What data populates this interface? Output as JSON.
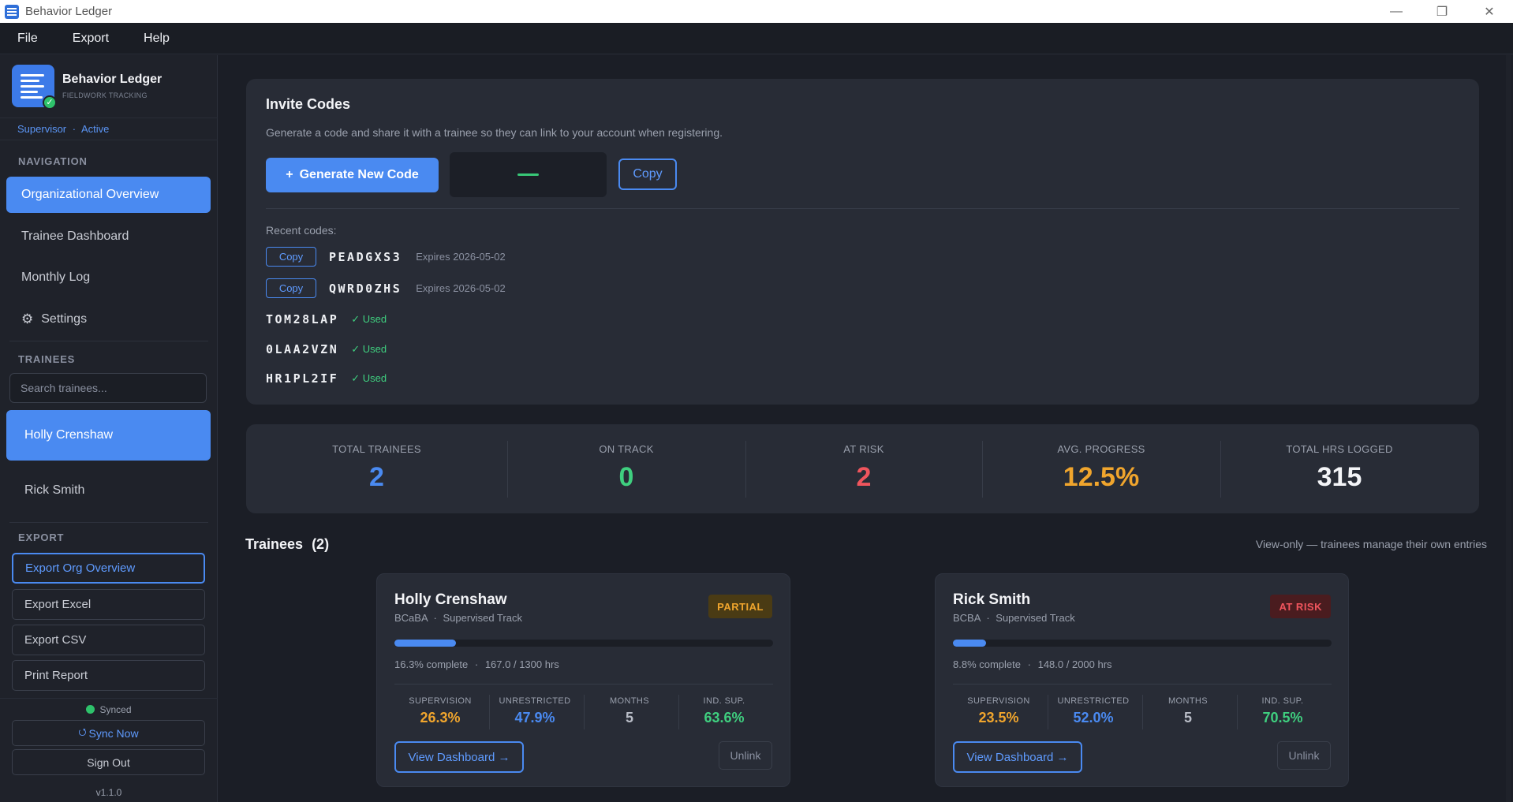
{
  "window": {
    "title": "Behavior Ledger",
    "controls": {
      "minimize": "—",
      "maximize": "❐",
      "close": "✕"
    }
  },
  "menu": [
    "File",
    "Export",
    "Help"
  ],
  "sidebar": {
    "brand": {
      "name": "Behavior Ledger",
      "tagline": "FIELDWORK TRACKING"
    },
    "role": "Supervisor",
    "status": "Active",
    "role_sep": "·",
    "nav_heading": "NAVIGATION",
    "nav": [
      "Organizational Overview",
      "Trainee Dashboard",
      "Monthly Log",
      "Settings"
    ],
    "trainees_heading": "TRAINEES",
    "search_placeholder": "Search trainees...",
    "trainees": [
      "Holly Crenshaw",
      "Rick Smith"
    ],
    "export_heading": "EXPORT",
    "export": [
      "Export Org Overview",
      "Export Excel",
      "Export CSV",
      "Print Report"
    ],
    "sync_status": "Synced",
    "sync_now": "Sync Now",
    "sync_icon": "⭯",
    "sign_out": "Sign Out",
    "version": "v1.1.0"
  },
  "invite": {
    "title": "Invite Codes",
    "description": "Generate a code and share it with a trainee so they can link to your account when registering.",
    "generate_label": "Generate New Code",
    "generate_icon": "+",
    "copy_label": "Copy",
    "recent_label": "Recent codes:",
    "codes": [
      {
        "code": "PEADGXS3",
        "status": "Expires 2026-05-02",
        "copy": "Copy"
      },
      {
        "code": "QWRD0ZHS",
        "status": "Expires 2026-05-02",
        "copy": "Copy"
      },
      {
        "code": "TOM28LAP",
        "status": "✓ Used"
      },
      {
        "code": "0LAA2VZN",
        "status": "✓ Used"
      },
      {
        "code": "HR1PL2IF",
        "status": "✓ Used"
      }
    ]
  },
  "stats": [
    {
      "label": "TOTAL TRAINEES",
      "value": "2",
      "color": "#4a8af1"
    },
    {
      "label": "ON TRACK",
      "value": "0",
      "color": "#3fcf7f"
    },
    {
      "label": "AT RISK",
      "value": "2",
      "color": "#f0555d"
    },
    {
      "label": "AVG. PROGRESS",
      "value": "12.5%",
      "color": "#f0a52d"
    },
    {
      "label": "TOTAL HRS LOGGED",
      "value": "315",
      "color": "#f3f4f7"
    }
  ],
  "trainees_section": {
    "title": "Trainees",
    "count": "(2)",
    "note": "View-only — trainees manage their own entries"
  },
  "trainee_cards": [
    {
      "name": "Holly Crenshaw",
      "credential": "BCaBA",
      "track": "Supervised Track",
      "badge": "PARTIAL",
      "progress_fraction": 0.163,
      "progress_text": "16.3% complete",
      "hours_text": "167.0 / 1300 hrs",
      "metrics": [
        {
          "label": "SUPERVISION",
          "value": "26.3%",
          "color": "#f0a52d"
        },
        {
          "label": "UNRESTRICTED",
          "value": "47.9%",
          "color": "#4a8af1"
        },
        {
          "label": "MONTHS",
          "value": "5",
          "color": "#b9bdc7"
        },
        {
          "label": "IND. SUP.",
          "value": "63.6%",
          "color": "#3fcf7f"
        }
      ],
      "view_label": "View Dashboard →",
      "unlink_label": "Unlink"
    },
    {
      "name": "Rick Smith",
      "credential": "BCBA",
      "track": "Supervised Track",
      "badge": "AT RISK",
      "progress_fraction": 0.088,
      "progress_text": "8.8% complete",
      "hours_text": "148.0 / 2000 hrs",
      "metrics": [
        {
          "label": "SUPERVISION",
          "value": "23.5%",
          "color": "#f0a52d"
        },
        {
          "label": "UNRESTRICTED",
          "value": "52.0%",
          "color": "#4a8af1"
        },
        {
          "label": "MONTHS",
          "value": "5",
          "color": "#b9bdc7"
        },
        {
          "label": "IND. SUP.",
          "value": "70.5%",
          "color": "#3fcf7f"
        }
      ],
      "view_label": "View Dashboard →",
      "unlink_label": "Unlink"
    }
  ]
}
